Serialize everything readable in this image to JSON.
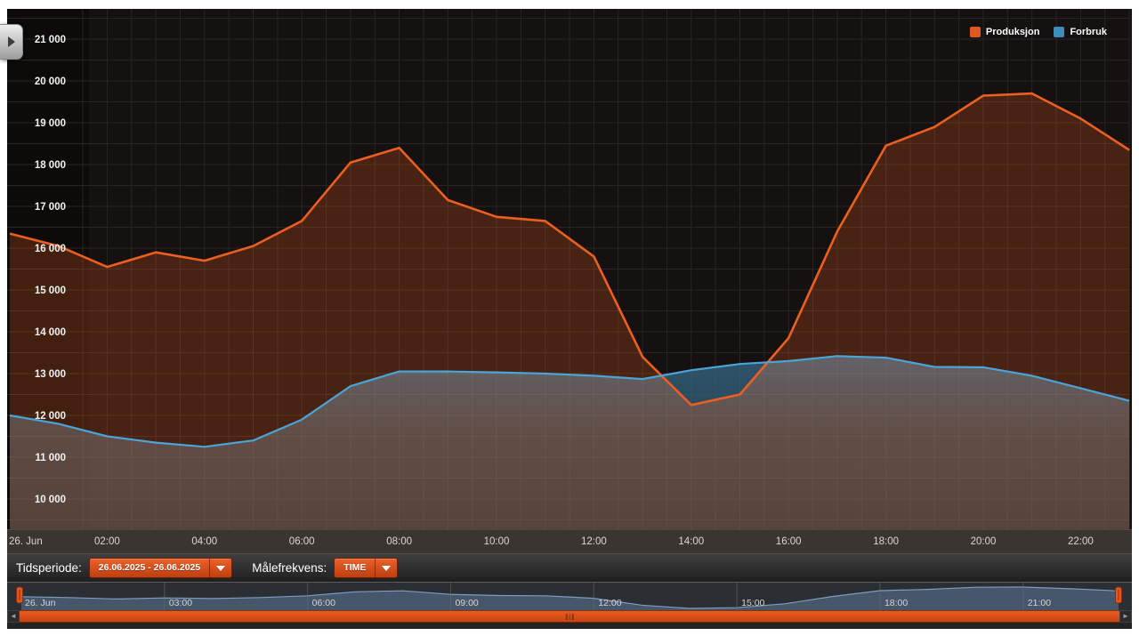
{
  "chart_data": {
    "type": "area",
    "title": "",
    "categories": [
      "00:00",
      "01:00",
      "02:00",
      "03:00",
      "04:00",
      "05:00",
      "06:00",
      "07:00",
      "08:00",
      "09:00",
      "10:00",
      "11:00",
      "12:00",
      "13:00",
      "14:00",
      "15:00",
      "16:00",
      "17:00",
      "18:00",
      "19:00",
      "20:00",
      "21:00",
      "22:00",
      "23:00"
    ],
    "series": [
      {
        "name": "Produksjon",
        "color": "#e8571c",
        "values": [
          16350,
          16050,
          15550,
          15900,
          15700,
          16050,
          16650,
          18050,
          18400,
          17150,
          16750,
          16650,
          15800,
          13400,
          12250,
          12500,
          13850,
          16400,
          18450,
          18900,
          19650,
          19700,
          19100,
          18350
        ]
      },
      {
        "name": "Forbruk",
        "color": "#4aa4d8",
        "values": [
          12000,
          11800,
          11500,
          11350,
          11250,
          11400,
          11900,
          12700,
          13050,
          13050,
          13030,
          13000,
          12950,
          12870,
          13080,
          13230,
          13300,
          13420,
          13380,
          13160,
          13150,
          12950,
          12650,
          12350
        ]
      }
    ],
    "ylim": [
      9750,
      21700
    ],
    "grid": true,
    "legend_position": "top-right",
    "y_labels": [
      "21 000",
      "20 000",
      "19 000",
      "18 000",
      "17 000",
      "16 000",
      "15 000",
      "14 000",
      "13 000",
      "12 000",
      "11 000",
      "10 000"
    ],
    "y_label_values": [
      21000,
      20000,
      19000,
      18000,
      17000,
      16000,
      15000,
      14000,
      13000,
      12000,
      11000,
      10000
    ],
    "x_labels": [
      "26. Jun",
      "02:00",
      "04:00",
      "06:00",
      "08:00",
      "10:00",
      "12:00",
      "14:00",
      "16:00",
      "18:00",
      "20:00",
      "22:00"
    ],
    "x_label_hours": [
      0,
      2,
      4,
      6,
      8,
      10,
      12,
      14,
      16,
      18,
      20,
      22
    ]
  },
  "legend": {
    "items": [
      {
        "label": "Produksjon",
        "color": "#e2571f"
      },
      {
        "label": "Forbruk",
        "color": "#3d8cba"
      }
    ]
  },
  "controls": {
    "tidsperiode_label": "Tidsperiode:",
    "tidsperiode_value": "26.06.2025 - 26.06.2025",
    "malefrekvens_label": "Målefrekvens:",
    "malefrekvens_value": "TIME"
  },
  "navigator": {
    "tick_labels": [
      "26. Jun",
      "03:00",
      "06:00",
      "09:00",
      "12:00",
      "15:00",
      "18:00",
      "21:00"
    ],
    "tick_hours": [
      0,
      3,
      6,
      9,
      12,
      15,
      18,
      21
    ]
  },
  "colors": {
    "background": "#141110",
    "gutter": "#0d0b0a",
    "grid_line": "#292623",
    "axis_band": "#3a3531",
    "produksjon_line": "#ed5f21",
    "produksjon_fill": "rgba(226,87,31,0.26)",
    "forbruk_line": "#4aa4d8",
    "teal_overlap": "rgba(15,75,110,0.5)",
    "nav_fill": "#46566b",
    "nav_line": "#7e9cc0",
    "nav_bg": "#2b2e33",
    "handle_fill": "#e2571f",
    "handle_stroke": "#8a2a0a",
    "scrollbar_orange": "#e0521c"
  }
}
